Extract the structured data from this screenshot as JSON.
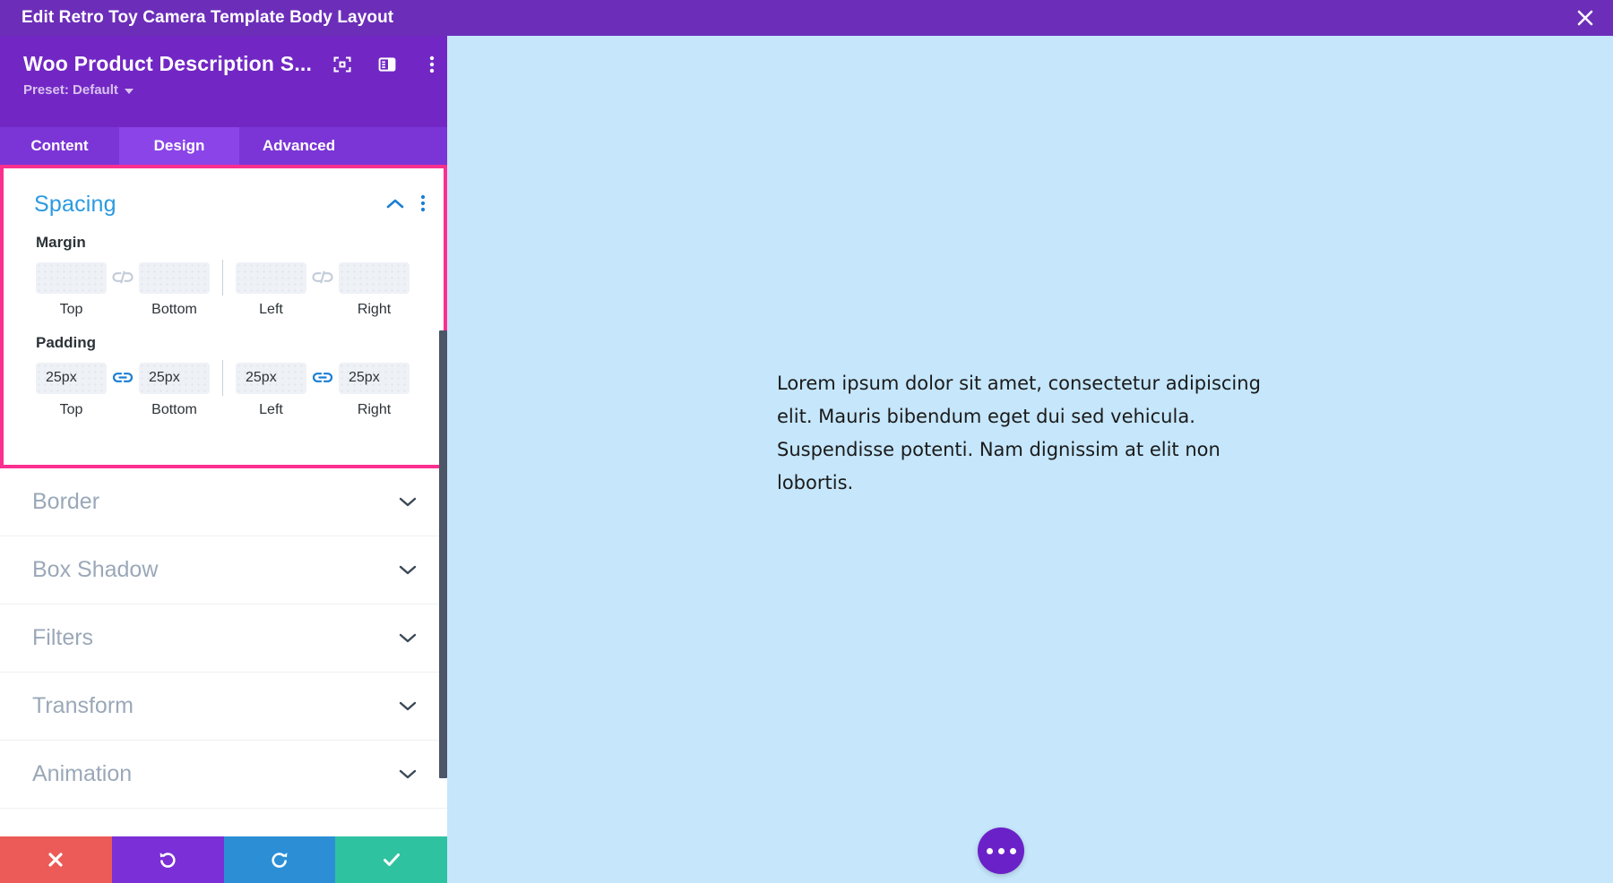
{
  "window": {
    "title": "Edit Retro Toy Camera Template Body Layout",
    "close_label": "close-icon"
  },
  "panel": {
    "module_title": "Woo Product Description S...",
    "preset_label": "Preset: Default",
    "header_icons": [
      {
        "name": "focus-target-icon"
      },
      {
        "name": "layout-panel-icon"
      },
      {
        "name": "more-vertical-icon"
      }
    ],
    "tabs": [
      {
        "label": "Content",
        "active": false
      },
      {
        "label": "Design",
        "active": true
      },
      {
        "label": "Advanced",
        "active": false
      }
    ],
    "spacing_section": {
      "title": "Spacing",
      "expanded": true,
      "collapse_icon": "chevron-up-icon",
      "menu_icon": "more-vertical-icon",
      "margin": {
        "label": "Margin",
        "linked_left": false,
        "linked_right": false,
        "fields": [
          {
            "sublabel": "Top",
            "value": "",
            "placeholder": ""
          },
          {
            "sublabel": "Bottom",
            "value": "",
            "placeholder": ""
          },
          {
            "sublabel": "Left",
            "value": "",
            "placeholder": ""
          },
          {
            "sublabel": "Right",
            "value": "",
            "placeholder": ""
          }
        ]
      },
      "padding": {
        "label": "Padding",
        "linked_left": true,
        "linked_right": true,
        "fields": [
          {
            "sublabel": "Top",
            "value": "25px"
          },
          {
            "sublabel": "Bottom",
            "value": "25px"
          },
          {
            "sublabel": "Left",
            "value": "25px"
          },
          {
            "sublabel": "Right",
            "value": "25px"
          }
        ]
      }
    },
    "collapsed_sections": [
      {
        "label": "Border",
        "icon": "chevron-down-icon"
      },
      {
        "label": "Box Shadow",
        "icon": "chevron-down-icon"
      },
      {
        "label": "Filters",
        "icon": "chevron-down-icon"
      },
      {
        "label": "Transform",
        "icon": "chevron-down-icon"
      },
      {
        "label": "Animation",
        "icon": "chevron-down-icon"
      }
    ],
    "actions": [
      {
        "name": "cancel",
        "icon": "close-x-icon",
        "color": "#ec5b57"
      },
      {
        "name": "undo",
        "icon": "undo-arrow-icon",
        "color": "#7b2fd6"
      },
      {
        "name": "redo",
        "icon": "redo-arrow-icon",
        "color": "#2c8fd6"
      },
      {
        "name": "save",
        "icon": "check-icon",
        "color": "#2fc2a0"
      }
    ]
  },
  "preview": {
    "background_color": "#c5e6fb",
    "body_text": "Lorem ipsum dolor sit amet, consectetur adipiscing elit. Mauris bibendum eget dui sed vehicula. Suspendisse potenti. Nam dignissim at elit non lobortis.",
    "fab_icon": "ellipsis-icon"
  },
  "colors": {
    "window_bar": "#6c2eb9",
    "panel_header": "#7227c4",
    "tab_bar": "#7b35d6",
    "tab_active": "#8b44e8",
    "highlight_border": "#fb2f8f",
    "section_title": "#2a9ae1",
    "link_active": "#1a7fd4"
  }
}
